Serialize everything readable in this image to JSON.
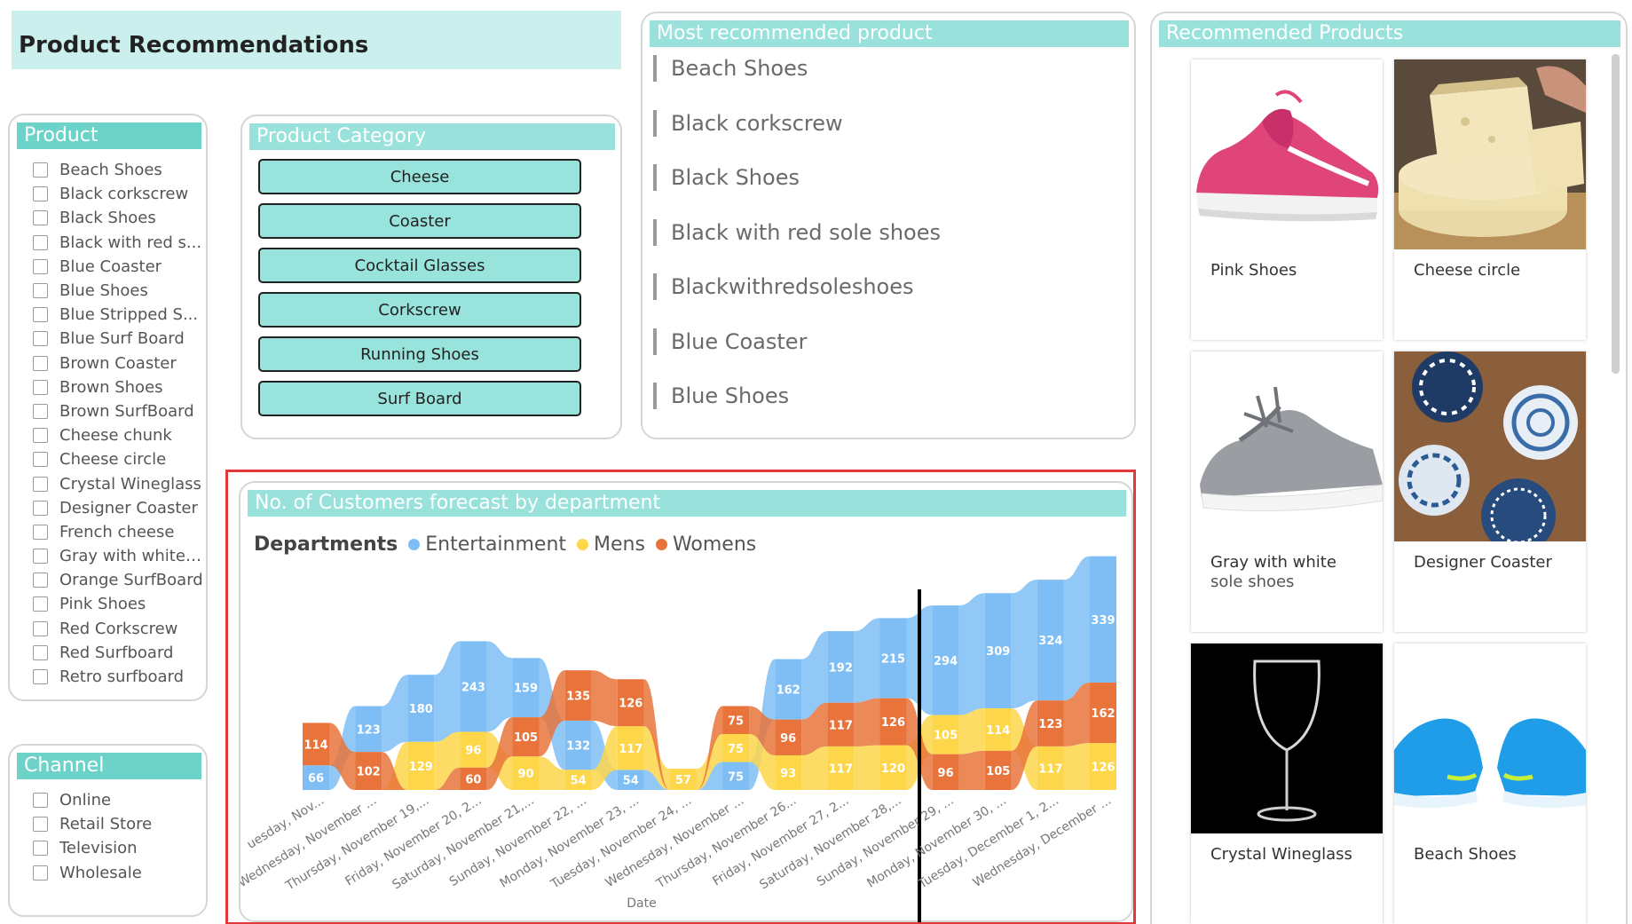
{
  "title": "Product Recommendations",
  "product_slicer": {
    "header": "Product",
    "items": [
      "Beach Shoes",
      "Black corkscrew",
      "Black Shoes",
      "Black with red s...",
      "Blue Coaster",
      "Blue Shoes",
      "Blue Stripped S...",
      "Blue Surf Board",
      "Brown Coaster",
      "Brown Shoes",
      "Brown SurfBoard",
      "Cheese chunk",
      "Cheese circle",
      "Crystal Wineglass",
      "Designer Coaster",
      "French cheese",
      "Gray with white ...",
      "Orange SurfBoard",
      "Pink Shoes",
      "Red Corkscrew",
      "Red Surfboard",
      "Retro surfboard"
    ]
  },
  "channel_slicer": {
    "header": "Channel",
    "items": [
      "Online",
      "Retail Store",
      "Television",
      "Wholesale"
    ]
  },
  "category": {
    "header": "Product Category",
    "buttons": [
      "Cheese",
      "Coaster",
      "Cocktail Glasses",
      "Corkscrew",
      "Running Shoes",
      "Surf Board"
    ]
  },
  "most_recommended": {
    "header": "Most recommended product",
    "items": [
      "Beach Shoes",
      "Black corkscrew",
      "Black Shoes",
      "Black with red sole shoes",
      "Blackwithredsoleshoes",
      "Blue Coaster",
      "Blue Shoes"
    ]
  },
  "recommended": {
    "header": "Recommended Products",
    "cards": [
      {
        "name": "Pink Shoes",
        "sub": ""
      },
      {
        "name": "Cheese circle",
        "sub": ""
      },
      {
        "name": "Gray with white",
        "sub": "sole shoes"
      },
      {
        "name": "Designer Coaster",
        "sub": ""
      },
      {
        "name": "Crystal Wineglass",
        "sub": ""
      },
      {
        "name": "Beach Shoes",
        "sub": ""
      }
    ]
  },
  "colors": {
    "accent": "#99e2dc",
    "slicer_header": "#6dd3c9",
    "entertainment": "#7fbef5",
    "mens": "#fdd64a",
    "womens": "#e8743b",
    "highlight": "#e23a3a"
  },
  "chart_header": "No. of Customers forecast by department",
  "chart_data": {
    "type": "area",
    "subtype": "ribbon",
    "legend_title": "Departments",
    "legend_position": "top-left",
    "xlabel": "Date",
    "x": [
      "Tuesday, Nov...",
      "Wednesday, November ...",
      "Thursday, November 19,...",
      "Friday, November 20, 2...",
      "Saturday, November 21,...",
      "Sunday, November 22, ...",
      "Monday, November 23, ...",
      "Tuesday, November 24, ...",
      "Wednesday, November ...",
      "Thursday, November 26...",
      "Friday, November 27, 2...",
      "Saturday, November 28,...",
      "Sunday, November 29, ...",
      "Monday, November 30, ...",
      "Tuesday, December 1, 2...",
      "Wednesday, December ..."
    ],
    "x_visible_labels": [
      "uesday, Nov...",
      "Wednesday, November ...",
      "Thursday, November 19,...",
      "Friday, November 20, 2...",
      "Saturday, November 21,...",
      "Sunday, November 22, ...",
      "Monday, November 23, ...",
      "Tuesday, November 24, ...",
      "Wednesday, November ...",
      "Thursday, November 26...",
      "Friday, November 27, 2...",
      "Saturday, November 28,...",
      "Sunday, November 29, ...",
      "Monday, November 30, ...",
      "Tuesday, December 1, 2...",
      "Wednesday, December ..."
    ],
    "series": [
      {
        "name": "Entertainment",
        "values": [
          66,
          123,
          180,
          243,
          159,
          132,
          54,
          null,
          75,
          162,
          192,
          215,
          294,
          309,
          324,
          339
        ]
      },
      {
        "name": "Mens",
        "values": [
          null,
          null,
          129,
          96,
          90,
          54,
          117,
          57,
          75,
          93,
          117,
          120,
          105,
          114,
          117,
          126
        ]
      },
      {
        "name": "Womens",
        "values": [
          114,
          102,
          null,
          60,
          105,
          135,
          126,
          null,
          75,
          96,
          117,
          126,
          96,
          105,
          123,
          162
        ]
      }
    ],
    "grid": false,
    "reference_line_at_index": 11.5
  }
}
